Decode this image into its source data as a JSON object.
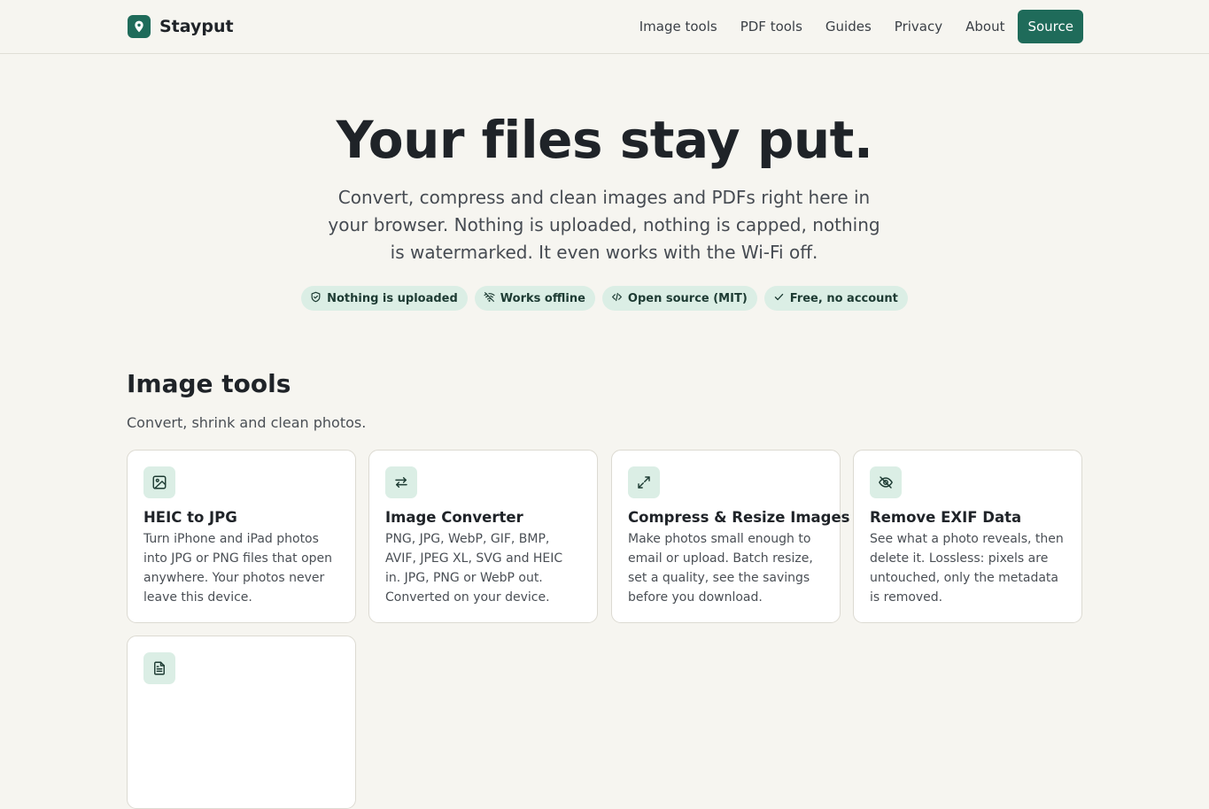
{
  "header": {
    "brand": "Stayput",
    "nav": [
      {
        "label": "Image tools"
      },
      {
        "label": "PDF tools"
      },
      {
        "label": "Guides"
      },
      {
        "label": "Privacy"
      },
      {
        "label": "About"
      }
    ],
    "source_label": "Source"
  },
  "hero": {
    "title": "Your files stay put.",
    "subtitle": "Convert, compress and clean images and PDFs right here in your browser. Nothing is uploaded, nothing is capped, nothing is watermarked. It even works with the Wi-Fi off.",
    "badges": [
      {
        "label": "Nothing is uploaded",
        "icon": "shield-icon"
      },
      {
        "label": "Works offline",
        "icon": "wifi-off-icon"
      },
      {
        "label": "Open source (MIT)",
        "icon": "code-icon"
      },
      {
        "label": "Free, no account",
        "icon": "check-icon"
      }
    ]
  },
  "image_tools": {
    "title": "Image tools",
    "subtitle": "Convert, shrink and clean photos.",
    "cards": [
      {
        "title": "HEIC to JPG",
        "description": "Turn iPhone and iPad photos into JPG or PNG files that open anywhere. Your photos never leave this device.",
        "icon": "image-icon"
      },
      {
        "title": "Image Converter",
        "description": "PNG, JPG, WebP, GIF, BMP, AVIF, JPEG XL, SVG and HEIC in. JPG, PNG or WebP out. Converted on your device.",
        "icon": "swap-arrows-icon"
      },
      {
        "title": "Compress & Resize Images",
        "description": "Make photos small enough to email or upload. Batch resize, set a quality, see the savings before you download.",
        "icon": "expand-icon"
      },
      {
        "title": "Remove EXIF Data",
        "description": "See what a photo reveals, then delete it. Lossless: pixels are untouched, only the metadata is removed.",
        "icon": "eye-off-icon"
      },
      {
        "title": "",
        "description": "",
        "icon": "document-icon"
      }
    ]
  },
  "colors": {
    "accent": "#1f6b5a",
    "pill_bg": "#dbeee5",
    "page_bg": "#f6f5f0"
  }
}
